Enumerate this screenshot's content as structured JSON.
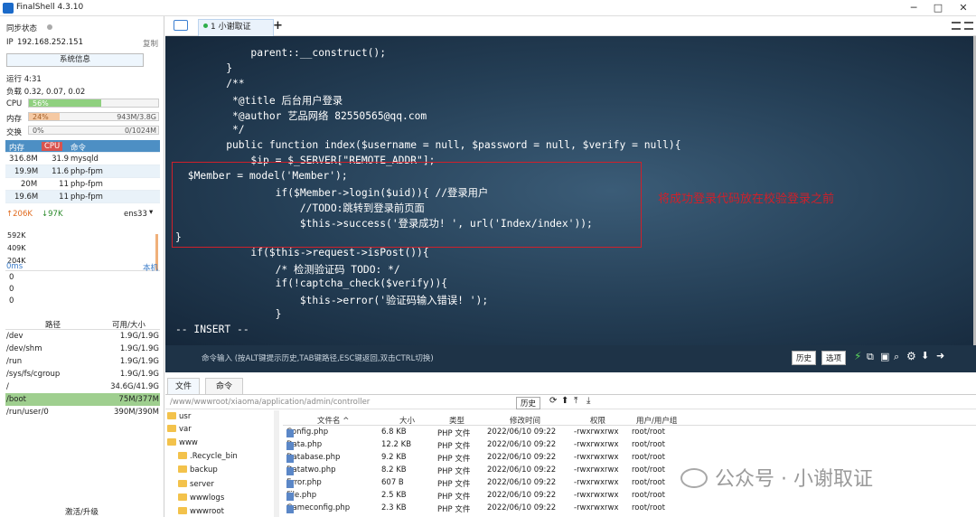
{
  "app": {
    "title": "FinalShell 4.3.10",
    "minimize": "─",
    "maximize": "□",
    "close": "✕"
  },
  "sidebar": {
    "sync_label": "同步状态",
    "ip_label": "IP",
    "ip": "192.168.252.151",
    "copy": "复制",
    "sysinfo_button": "系统信息",
    "uptime": "运行 4:31",
    "load": "负载 0.32, 0.07, 0.02",
    "cpu_label": "CPU",
    "cpu_text": "56%",
    "cpu_pct": 56,
    "mem_label": "内存",
    "mem_text": "24%",
    "mem_pct": 24,
    "mem_val": "943M/3.8G",
    "swap_label": "交换",
    "swap_text": "0%",
    "swap_val": "0/1024M",
    "proc_headers": [
      "内存",
      "CPU",
      "命令"
    ],
    "procs": [
      {
        "mem": "316.8M",
        "cpu": "31.9",
        "cmd": "mysqld"
      },
      {
        "mem": "19.9M",
        "cpu": "11.6",
        "cmd": "php-fpm"
      },
      {
        "mem": "20M",
        "cpu": "11",
        "cmd": "php-fpm"
      },
      {
        "mem": "19.6M",
        "cpu": "11",
        "cmd": "php-fpm"
      }
    ],
    "net_up": "↑206K",
    "net_down": "↓97K",
    "iface": "ens33",
    "net_scale": [
      "592K",
      "409K",
      "204K"
    ],
    "ping": "0ms",
    "local": "本机",
    "ping_vals": [
      "0",
      "0",
      "0"
    ],
    "disk_headers": [
      "路径",
      "可用/大小"
    ],
    "disks": [
      {
        "path": "/dev",
        "size": "1.9G/1.9G"
      },
      {
        "path": "/dev/shm",
        "size": "1.9G/1.9G"
      },
      {
        "path": "/run",
        "size": "1.9G/1.9G"
      },
      {
        "path": "/sys/fs/cgroup",
        "size": "1.9G/1.9G"
      },
      {
        "path": "/",
        "size": "34.6G/41.9G"
      },
      {
        "path": "/boot",
        "size": "75M/377M"
      },
      {
        "path": "/run/user/0",
        "size": "390M/390M"
      }
    ],
    "upgrade": "激活/升级"
  },
  "tabs": {
    "session": "1 小谢取证",
    "add": "+"
  },
  "terminal": {
    "lines": [
      "        parent::__construct();",
      "    }",
      "    /**",
      "     *@title 后台用户登录",
      "     *@author 艺品网络 82550565@qq.com",
      "     */",
      "    public function index($username = null, $password = null, $verify = null){",
      "        $ip = $_SERVER[\"REMOTE_ADDR\"];",
      " $Member = model('Member');",
      "            if($Member->login($uid)){ //登录用户",
      "                //TODO:跳转到登录前页面",
      "                $this->success('登录成功! ', url('Index/index'));",
      "}",
      "        if($this->request->isPost()){",
      "            /* 检测验证码 TODO: */",
      "            if(!captcha_check($verify)){",
      "                $this->error('验证码输入错误! ');",
      "            }",
      "-- INSERT --"
    ]
  },
  "cmdbar": {
    "hint": "命令输入 (按ALT键提示历史,TAB键路径,ESC键返回,双击CTRL切换)",
    "history": "历史",
    "options": "选项"
  },
  "files": {
    "tab_files": "文件",
    "tab_commands": "命令",
    "path": "/www/wwwroot/xiaoma/application/admin/controller",
    "history": "历史",
    "tree": [
      "usr",
      "var",
      "www",
      ".Recycle_bin",
      "backup",
      "server",
      "wwwlogs",
      "wwwroot"
    ],
    "headers": [
      "文件名 ^",
      "大小",
      "类型",
      "修改时间",
      "权限",
      "用户/用户组"
    ],
    "rows": [
      {
        "name": "Config.php",
        "size": "6.8 KB",
        "type": "PHP 文件",
        "time": "2022/06/10 09:22",
        "perm": "-rwxrwxrwx",
        "owner": "root/root"
      },
      {
        "name": "Data.php",
        "size": "12.2 KB",
        "type": "PHP 文件",
        "time": "2022/06/10 09:22",
        "perm": "-rwxrwxrwx",
        "owner": "root/root"
      },
      {
        "name": "Database.php",
        "size": "9.2 KB",
        "type": "PHP 文件",
        "time": "2022/06/10 09:22",
        "perm": "-rwxrwxrwx",
        "owner": "root/root"
      },
      {
        "name": "Datatwo.php",
        "size": "8.2 KB",
        "type": "PHP 文件",
        "time": "2022/06/10 09:22",
        "perm": "-rwxrwxrwx",
        "owner": "root/root"
      },
      {
        "name": "Error.php",
        "size": "607 B",
        "type": "PHP 文件",
        "time": "2022/06/10 09:22",
        "perm": "-rwxrwxrwx",
        "owner": "root/root"
      },
      {
        "name": "File.php",
        "size": "2.5 KB",
        "type": "PHP 文件",
        "time": "2022/06/10 09:22",
        "perm": "-rwxrwxrwx",
        "owner": "root/root"
      },
      {
        "name": "Gameconfig.php",
        "size": "2.3 KB",
        "type": "PHP 文件",
        "time": "2022/06/10 09:22",
        "perm": "-rwxrwxrwx",
        "owner": "root/root"
      }
    ]
  },
  "annotation": "将成功登录代码放在校验登录之前",
  "watermark": "公众号 · 小谢取证"
}
